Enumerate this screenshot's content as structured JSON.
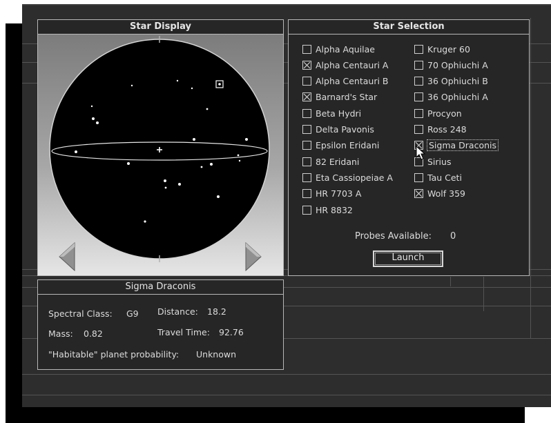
{
  "star_display": {
    "title": "Star Display"
  },
  "star_selection": {
    "title": "Star Selection",
    "left_column": [
      {
        "label": "Alpha Aquilae",
        "checked": false
      },
      {
        "label": "Alpha Centauri A",
        "checked": true
      },
      {
        "label": "Alpha Centauri B",
        "checked": false
      },
      {
        "label": "Barnard's Star",
        "checked": true
      },
      {
        "label": "Beta Hydri",
        "checked": false
      },
      {
        "label": "Delta Pavonis",
        "checked": false
      },
      {
        "label": "Epsilon Eridani",
        "checked": false
      },
      {
        "label": "82 Eridani",
        "checked": false
      },
      {
        "label": "Eta Cassiopeiae A",
        "checked": false
      },
      {
        "label": "HR 7703 A",
        "checked": false
      },
      {
        "label": "HR 8832",
        "checked": false
      }
    ],
    "right_column": [
      {
        "label": "Kruger 60",
        "checked": false
      },
      {
        "label": "70 Ophiuchi A",
        "checked": false
      },
      {
        "label": "36 Ophiuchi B",
        "checked": false
      },
      {
        "label": "36 Ophiuchi A",
        "checked": false
      },
      {
        "label": "Procyon",
        "checked": false
      },
      {
        "label": "Ross 248",
        "checked": false
      },
      {
        "label": "Sigma Draconis",
        "checked": true,
        "focused": true
      },
      {
        "label": "Sirius",
        "checked": false
      },
      {
        "label": "Tau Ceti",
        "checked": false
      },
      {
        "label": "Wolf 359",
        "checked": true
      }
    ],
    "probes_label": "Probes Available:",
    "probes_value": "0",
    "launch_label": "Launch"
  },
  "info": {
    "star_name": "Sigma Draconis",
    "spectral_label": "Spectral Class:",
    "spectral_value": "G9",
    "distance_label": "Distance:",
    "distance_value": "18.2",
    "mass_label": "Mass:",
    "mass_value": "0.82",
    "travel_label": "Travel Time:",
    "travel_value": "92.76",
    "habitable_label": "\"Habitable\" planet probability:",
    "habitable_value": "Unknown"
  },
  "icons": {
    "rotate_left": "left-triangle-arrow",
    "rotate_right": "right-triangle-arrow",
    "pointer": "mouse-cursor"
  },
  "colors": {
    "background": "#2d2d2d",
    "panel": "#262626",
    "border": "#b8b8b8",
    "text": "#dcdcdc",
    "sphere": "#000000"
  }
}
